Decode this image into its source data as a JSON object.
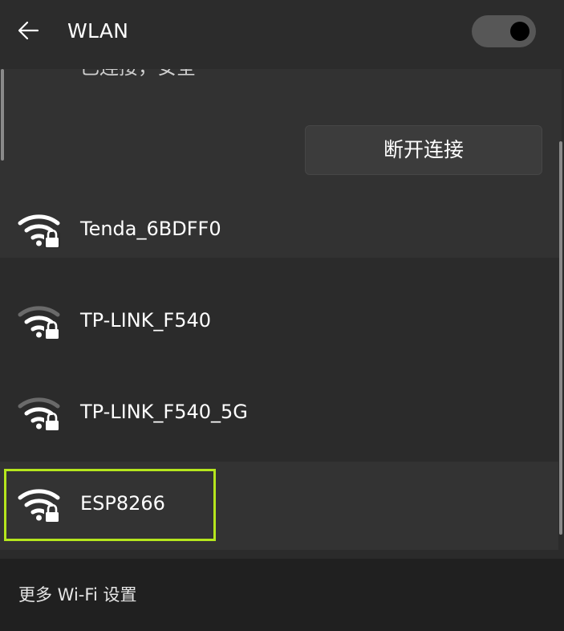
{
  "header": {
    "title": "WLAN",
    "back_icon": "arrow-left-icon",
    "wifi_toggle_on": true
  },
  "connected": {
    "status": "已连接，安全",
    "disconnect_label": "断开连接"
  },
  "networks": [
    {
      "name": "Tenda_6BDFF0",
      "icon": "wifi-secured-icon",
      "signal_bars": 3,
      "selected": false
    },
    {
      "name": "TP-LINK_F540",
      "icon": "wifi-secured-icon",
      "signal_bars": 2,
      "selected": false
    },
    {
      "name": "TP-LINK_F540_5G",
      "icon": "wifi-secured-icon",
      "signal_bars": 2,
      "selected": false
    },
    {
      "name": "ESP8266",
      "icon": "wifi-secured-icon",
      "signal_bars": 3,
      "selected": true
    }
  ],
  "footer": {
    "more_settings": "更多 Wi-Fi 设置"
  },
  "colors": {
    "background": "#2b2b2b",
    "card": "#323232",
    "footer": "#202020",
    "highlight": "#b5e61d"
  }
}
